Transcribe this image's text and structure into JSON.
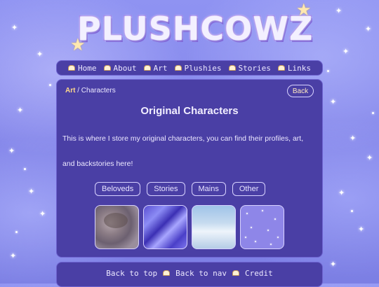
{
  "site": {
    "logo_text": "PLUSHCOWZ"
  },
  "nav": {
    "items": [
      {
        "label": "Home"
      },
      {
        "label": "About"
      },
      {
        "label": "Art"
      },
      {
        "label": "Plushies"
      },
      {
        "label": "Stories"
      },
      {
        "label": "Links"
      }
    ]
  },
  "breadcrumb": {
    "parent": "Art",
    "separator": "/",
    "current": "Characters"
  },
  "back_button": {
    "label": "Back"
  },
  "page": {
    "title": "Original Characters",
    "intro": "This is where I store my original characters, you can find their profiles, art, and backstories here!"
  },
  "tabs": [
    {
      "label": "Beloveds"
    },
    {
      "label": "Stories"
    },
    {
      "label": "Mains"
    },
    {
      "label": "Other"
    }
  ],
  "footer": {
    "items": [
      {
        "label": "Back to top"
      },
      {
        "label": "Back to nav"
      },
      {
        "label": "Credit"
      }
    ]
  },
  "colors": {
    "background": "#8d8ff0",
    "panel": "#4a3fa5",
    "accent_link": "#ffd98a",
    "text": "#ece8ff"
  }
}
